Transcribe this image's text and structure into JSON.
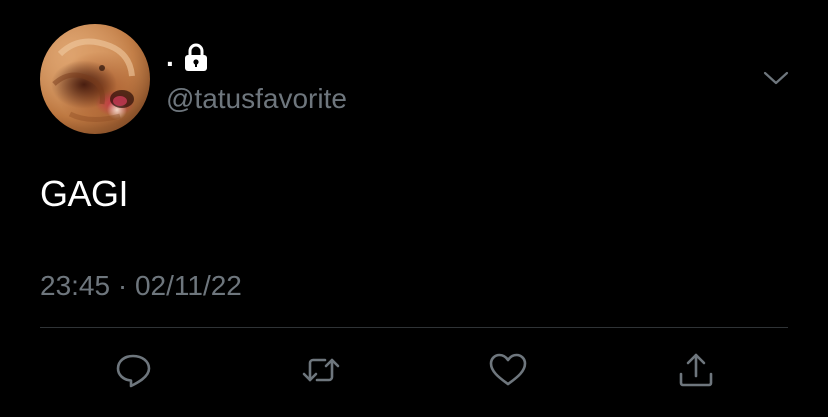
{
  "tweet": {
    "display_name": ".",
    "protected_icon": "lock-icon",
    "handle": "@tatusfavorite",
    "text": "GAGI",
    "timestamp": "23:45 · 02/11/22"
  },
  "icons": {
    "more": "chevron-down-icon",
    "reply": "speech-bubble-icon",
    "retweet": "retweet-arrows-icon",
    "like": "heart-icon",
    "share": "share-upload-icon"
  },
  "colors": {
    "background": "#000000",
    "primary_text": "#ffffff",
    "secondary_text": "#6e767d",
    "divider": "#2f3336",
    "icon": "#6e767d"
  }
}
